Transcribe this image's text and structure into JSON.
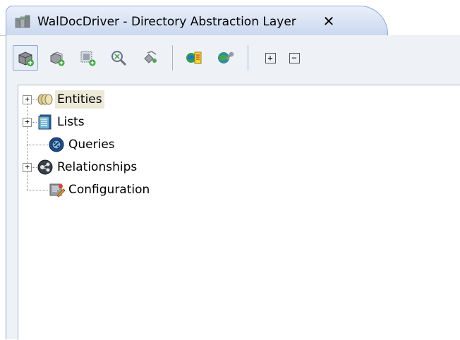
{
  "tab": {
    "title": "WalDocDriver - Directory Abstraction Layer",
    "close_symbol": "✕",
    "icon": "rack-icon"
  },
  "toolbar": {
    "buttons": [
      {
        "name": "new-entity-icon"
      },
      {
        "name": "new-list-icon"
      },
      {
        "name": "new-query-icon"
      },
      {
        "name": "find-icon"
      },
      {
        "name": "relationship-icon"
      },
      {
        "name": "catalog-icon"
      },
      {
        "name": "settings-globe-icon"
      },
      {
        "name": "expand-all-icon",
        "symbol": "+"
      },
      {
        "name": "collapse-all-icon",
        "symbol": "−"
      }
    ]
  },
  "tree": {
    "items": [
      {
        "label": "Entities",
        "icon": "entities-icon",
        "expandable": true,
        "selected": true
      },
      {
        "label": "Lists",
        "icon": "lists-icon",
        "expandable": true
      },
      {
        "label": "Queries",
        "icon": "queries-icon",
        "expandable": false
      },
      {
        "label": "Relationships",
        "icon": "relationships-icon",
        "expandable": true
      },
      {
        "label": "Configuration",
        "icon": "configuration-icon",
        "expandable": false
      }
    ],
    "expand_symbol": "+"
  },
  "colors": {
    "tab_bg": "#c9d7ee",
    "panel_bg": "#eef2f7",
    "selection_bg": "#ece9d8"
  }
}
